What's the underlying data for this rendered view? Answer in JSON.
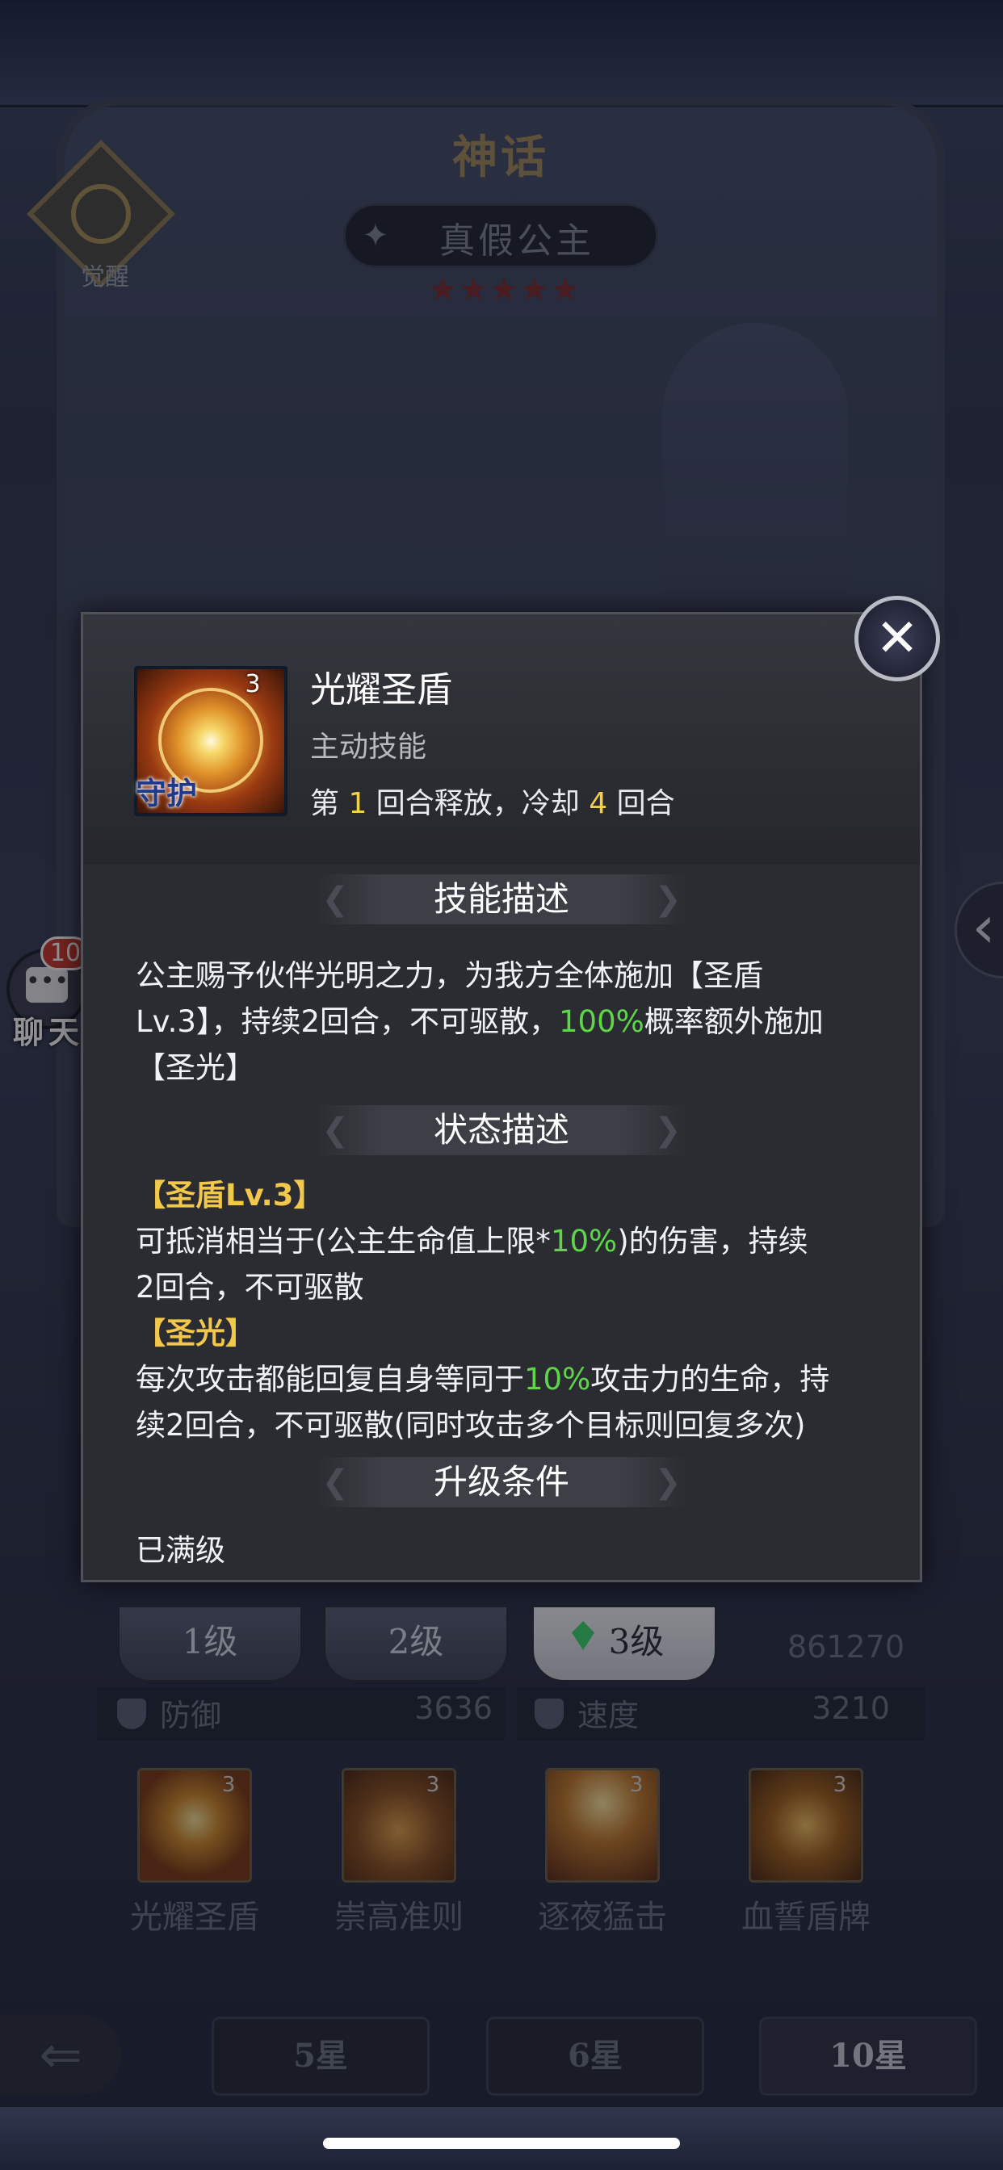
{
  "background": {
    "myth_title": "神话",
    "awaken_label": "觉醒",
    "hero_name": "真假公主",
    "stars": "★★★★★",
    "chat": {
      "badge": "10",
      "label": "聊天"
    },
    "levels": [
      "1级",
      "2级",
      "3级"
    ],
    "power_value": "861270",
    "stats": [
      {
        "label": "防御",
        "value": "3636"
      },
      {
        "label": "速度",
        "value": "3210"
      }
    ],
    "skills": [
      {
        "name": "光耀圣盾",
        "level": "3"
      },
      {
        "name": "崇高准则",
        "level": "3"
      },
      {
        "name": "逐夜猛击",
        "level": "3"
      },
      {
        "name": "血誓盾牌",
        "level": "3"
      }
    ],
    "star_tabs": [
      "5星",
      "6星",
      "10星"
    ]
  },
  "popup": {
    "skill_name": "光耀圣盾",
    "skill_type": "主动技能",
    "skill_icon_level": "3",
    "skill_icon_tag": "守护",
    "timing": {
      "prefix": "第 ",
      "turn": "1",
      "mid": " 回合释放，冷却 ",
      "cooldown": "4",
      "suffix": " 回合"
    },
    "sections": {
      "skill_desc_title": "技能描述",
      "status_desc_title": "状态描述",
      "upgrade_title": "升级条件"
    },
    "skill_desc": {
      "part1": "公主赐予伙伴光明之力，为我方全体施加【圣盾",
      "part2": "Lv.3】，持续2回合，不可驱散，",
      "highlight": "100%",
      "part3": "概率额外施加",
      "part4": "【圣光】"
    },
    "status_desc": {
      "shield_title": "【圣盾Lv.3】",
      "shield_line1_a": "可抵消相当于(公主生命值上限*",
      "shield_line1_hl": "10%",
      "shield_line1_b": ")的伤害，持续",
      "shield_line2": "2回合，不可驱散",
      "light_title": "【圣光】",
      "light_line1_a": "每次攻击都能回复自身等同于",
      "light_line1_hl": "10%",
      "light_line1_b": "攻击力的生命，持",
      "light_line2": "续2回合，不可驱散(同时攻击多个目标则回复多次)"
    },
    "upgrade_value": "已满级"
  },
  "colors": {
    "highlight_green": "#5ed64a",
    "highlight_yellow": "#f2d048",
    "title_gold": "#f2c84a"
  }
}
